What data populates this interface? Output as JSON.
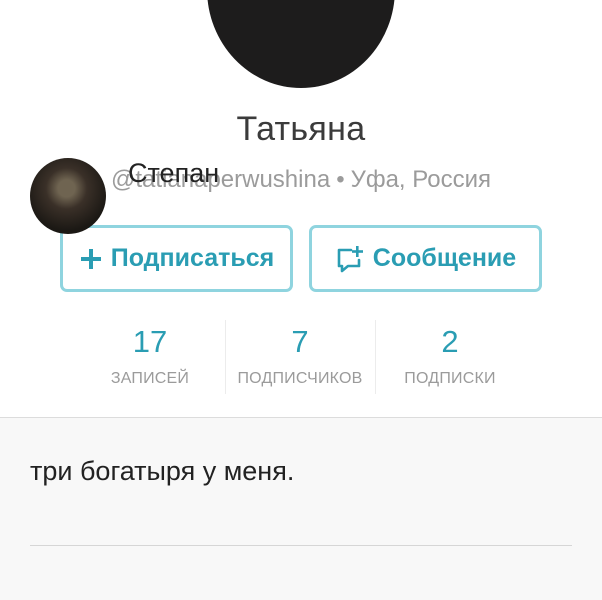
{
  "profile": {
    "name": "Татьяна",
    "handle": "@tatianaperwushina",
    "separator": "•",
    "location": "Уфа, Россия"
  },
  "actions": {
    "follow_label": "Подписаться",
    "message_label": "Сообщение",
    "follow_icon": "plus-icon",
    "message_icon": "message-add-icon"
  },
  "stats": [
    {
      "value": "17",
      "label": "ЗАПИСЕЙ"
    },
    {
      "value": "7",
      "label": "ПОДПИСЧИКОВ"
    },
    {
      "value": "2",
      "label": "ПОДПИСКИ"
    }
  ],
  "bio": "три богатыря у меня.",
  "comment": {
    "author": "Степан"
  },
  "colors": {
    "accent": "#2a9db3",
    "button_border": "#8fd4df",
    "muted_text": "#9b9b9b"
  }
}
